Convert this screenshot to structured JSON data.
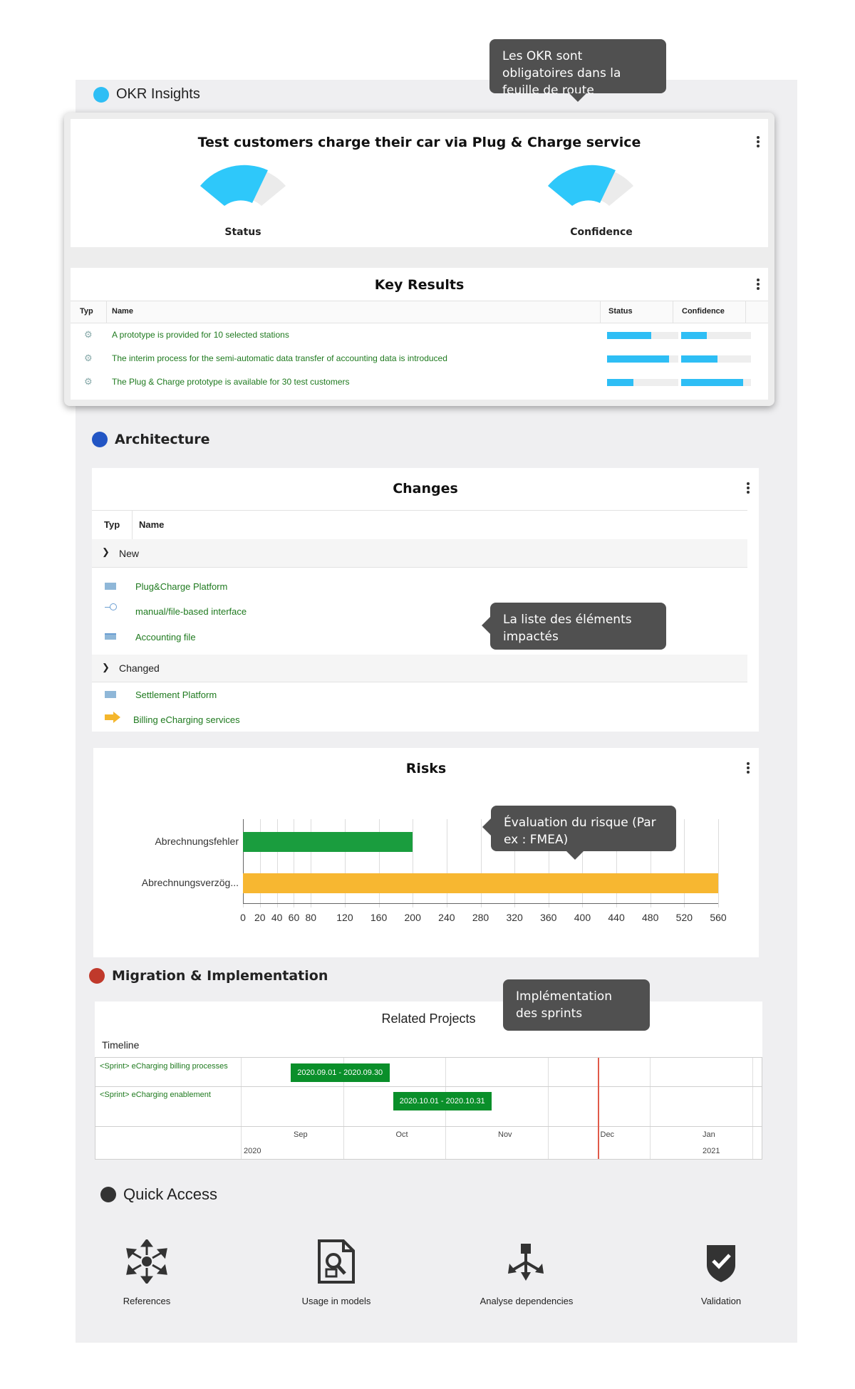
{
  "tooltips": {
    "okr": "Les OKR sont obligatoires dans la feuille de route",
    "changes": "La liste des éléments impactés",
    "risks": "Évaluation du risque (Par ex : FMEA)",
    "sprints": "Implémentation des sprints"
  },
  "okr": {
    "section_title": "OKR Insights",
    "objective_title": "Test customers charge their car via Plug & Charge service",
    "gauges": [
      {
        "label": "Status",
        "level": 0.78
      },
      {
        "label": "Confidence",
        "level": 0.78
      }
    ],
    "key_results": {
      "title": "Key Results",
      "columns": [
        "Typ",
        "Name",
        "Status",
        "Confidence"
      ],
      "rows": [
        {
          "name": "A prototype is provided for 10 selected stations",
          "status": 0.62,
          "confidence": 0.37
        },
        {
          "name": "The interim process for the semi-automatic data transfer of accounting data is introduced",
          "status": 0.87,
          "confidence": 0.52
        },
        {
          "name": "The Plug & Charge prototype is available for 30 test customers",
          "status": 0.37,
          "confidence": 0.89
        }
      ]
    }
  },
  "architecture": {
    "section_title": "Architecture",
    "changes": {
      "title": "Changes",
      "columns": [
        "Typ",
        "Name"
      ],
      "groups": [
        {
          "label": "New",
          "items": [
            {
              "name": "Plug&Charge Platform",
              "icon": "component-icon"
            },
            {
              "name": "manual/file-based interface",
              "icon": "interface-icon"
            },
            {
              "name": "Accounting file",
              "icon": "data-object-icon"
            }
          ]
        },
        {
          "label": "Changed",
          "items": [
            {
              "name": "Settlement Platform",
              "icon": "component-icon"
            },
            {
              "name": "Billing eCharging services",
              "icon": "service-arrow-icon"
            }
          ]
        }
      ]
    },
    "risks": {
      "title": "Risks"
    }
  },
  "chart_data": {
    "type": "bar",
    "orientation": "horizontal",
    "title": "Risks",
    "categories": [
      "Abrechnungsfehler",
      "Abrechnungsverzög..."
    ],
    "values": [
      200,
      560
    ],
    "colors": [
      "#1a9d3e",
      "#f7b731"
    ],
    "xlim": [
      0,
      560
    ],
    "xticks": [
      0,
      20,
      40,
      60,
      80,
      120,
      160,
      200,
      240,
      280,
      320,
      360,
      400,
      440,
      480,
      520,
      560
    ],
    "grid": true
  },
  "migration": {
    "section_title": "Migration & Implementation",
    "title": "Related Projects",
    "timeline_label": "Timeline",
    "rows": [
      {
        "name": "<Sprint> eCharging billing processes",
        "bar_label": "2020.09.01 - 2020.09.30",
        "start_month": 0,
        "span": 1
      },
      {
        "name": "<Sprint> eCharging enablement",
        "bar_label": "2020.10.01 - 2020.10.31",
        "start_month": 1,
        "span": 1
      }
    ],
    "months": [
      "Sep",
      "Oct",
      "Nov",
      "Dec",
      "Jan"
    ],
    "years": [
      "2020",
      "2021"
    ]
  },
  "quick_access": {
    "section_title": "Quick Access",
    "items": [
      {
        "label": "References",
        "icon": "references-icon"
      },
      {
        "label": "Usage in models",
        "icon": "usage-in-models-icon"
      },
      {
        "label": "Analyse dependencies",
        "icon": "analyse-dependencies-icon"
      },
      {
        "label": "Validation",
        "icon": "validation-shield-icon"
      }
    ]
  },
  "colors": {
    "okr_dot": "#2ebef5",
    "architecture_dot": "#2255c4",
    "migration_dot": "#c0392b",
    "quick_access_dot": "#333333",
    "gauge": "#2ec8fa",
    "sprint_bar": "#0a8f2a",
    "today_line": "#e05a4a"
  }
}
